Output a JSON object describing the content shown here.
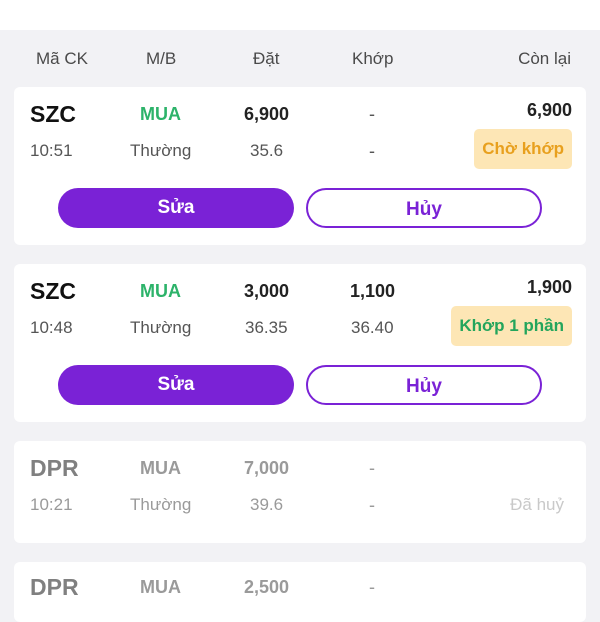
{
  "headers": {
    "symbol": "Mã CK",
    "side": "M/B",
    "order": "Đặt",
    "matched": "Khớp",
    "remaining": "Còn lại"
  },
  "orders": [
    {
      "symbol": "SZC",
      "side": "MUA",
      "order_qty": "6,900",
      "matched_qty": "-",
      "remaining": "6,900",
      "time": "10:51",
      "type": "Thường",
      "order_price": "35.6",
      "matched_price": "-",
      "status": "Chờ khớp",
      "edit_label": "Sửa",
      "cancel_label": "Hủy"
    },
    {
      "symbol": "SZC",
      "side": "MUA",
      "order_qty": "3,000",
      "matched_qty": "1,100",
      "remaining": "1,900",
      "time": "10:48",
      "type": "Thường",
      "order_price": "36.35",
      "matched_price": "36.40",
      "status": "Khớp 1 phần",
      "edit_label": "Sửa",
      "cancel_label": "Hủy"
    },
    {
      "symbol": "DPR",
      "side": "MUA",
      "order_qty": "7,000",
      "matched_qty": "-",
      "time": "10:21",
      "type": "Thường",
      "order_price": "39.6",
      "matched_price": "-",
      "status": "Đã huỷ"
    },
    {
      "symbol": "DPR",
      "side": "MUA",
      "order_qty": "2,500",
      "matched_qty": "-"
    }
  ],
  "colors": {
    "accent": "#7a22d6",
    "buy": "#2db36a",
    "pending_text": "#e8a01e",
    "badge_bg": "#fde6b5"
  },
  "icons": {
    "top": "shield-icon"
  }
}
